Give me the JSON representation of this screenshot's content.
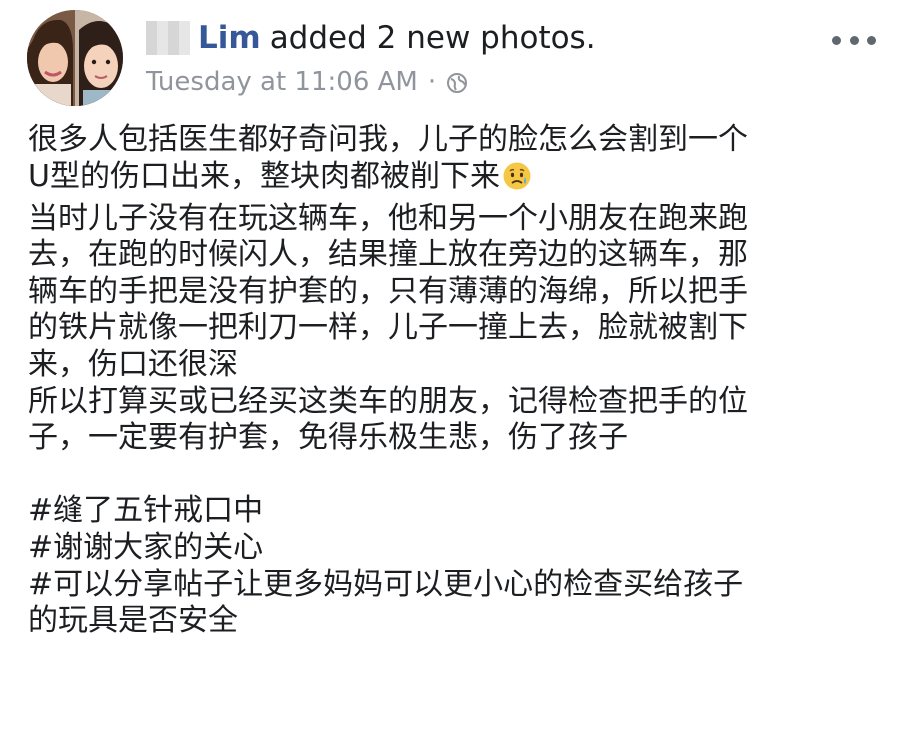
{
  "post": {
    "poster_name": "Lim",
    "action_text": "added 2 new photos.",
    "timestamp": "Tuesday at 11:06 AM",
    "meta_separator": "·",
    "privacy_icon": "globe-icon",
    "more_icon": "more-dots-icon"
  },
  "body": {
    "line1": "很多人包括医生都好奇问我，儿子的脸怎么会割到一个",
    "line2": "U型的伤口出来，整块肉都被削下来",
    "line2_emoji": "sad-relieved-face-emoji",
    "line3": "当时儿子没有在玩这辆车，他和另一个小朋友在跑来跑",
    "line4": "去，在跑的时候闪人，结果撞上放在旁边的这辆车，那",
    "line5": "辆车的手把是没有护套的，只有薄薄的海绵，所以把手",
    "line6": "的铁片就像一把利刀一样，儿子一撞上去，脸就被割下",
    "line7": "来，伤口还很深",
    "line8": "所以打算买或已经买这类车的朋友，记得检查把手的位",
    "line9": "子，一定要有护套，免得乐极生悲，伤了孩子",
    "hashtag1": "#缝了五针戒口中",
    "hashtag2": "#谢谢大家的关心",
    "hashtag3_line1": "#可以分享帖子让更多妈妈可以更小心的检查买给孩子",
    "hashtag3_line2": "的玩具是否安全"
  },
  "colors": {
    "name": "#365899",
    "text": "#1c1e21",
    "meta": "#90949c",
    "icon": "#606770"
  }
}
